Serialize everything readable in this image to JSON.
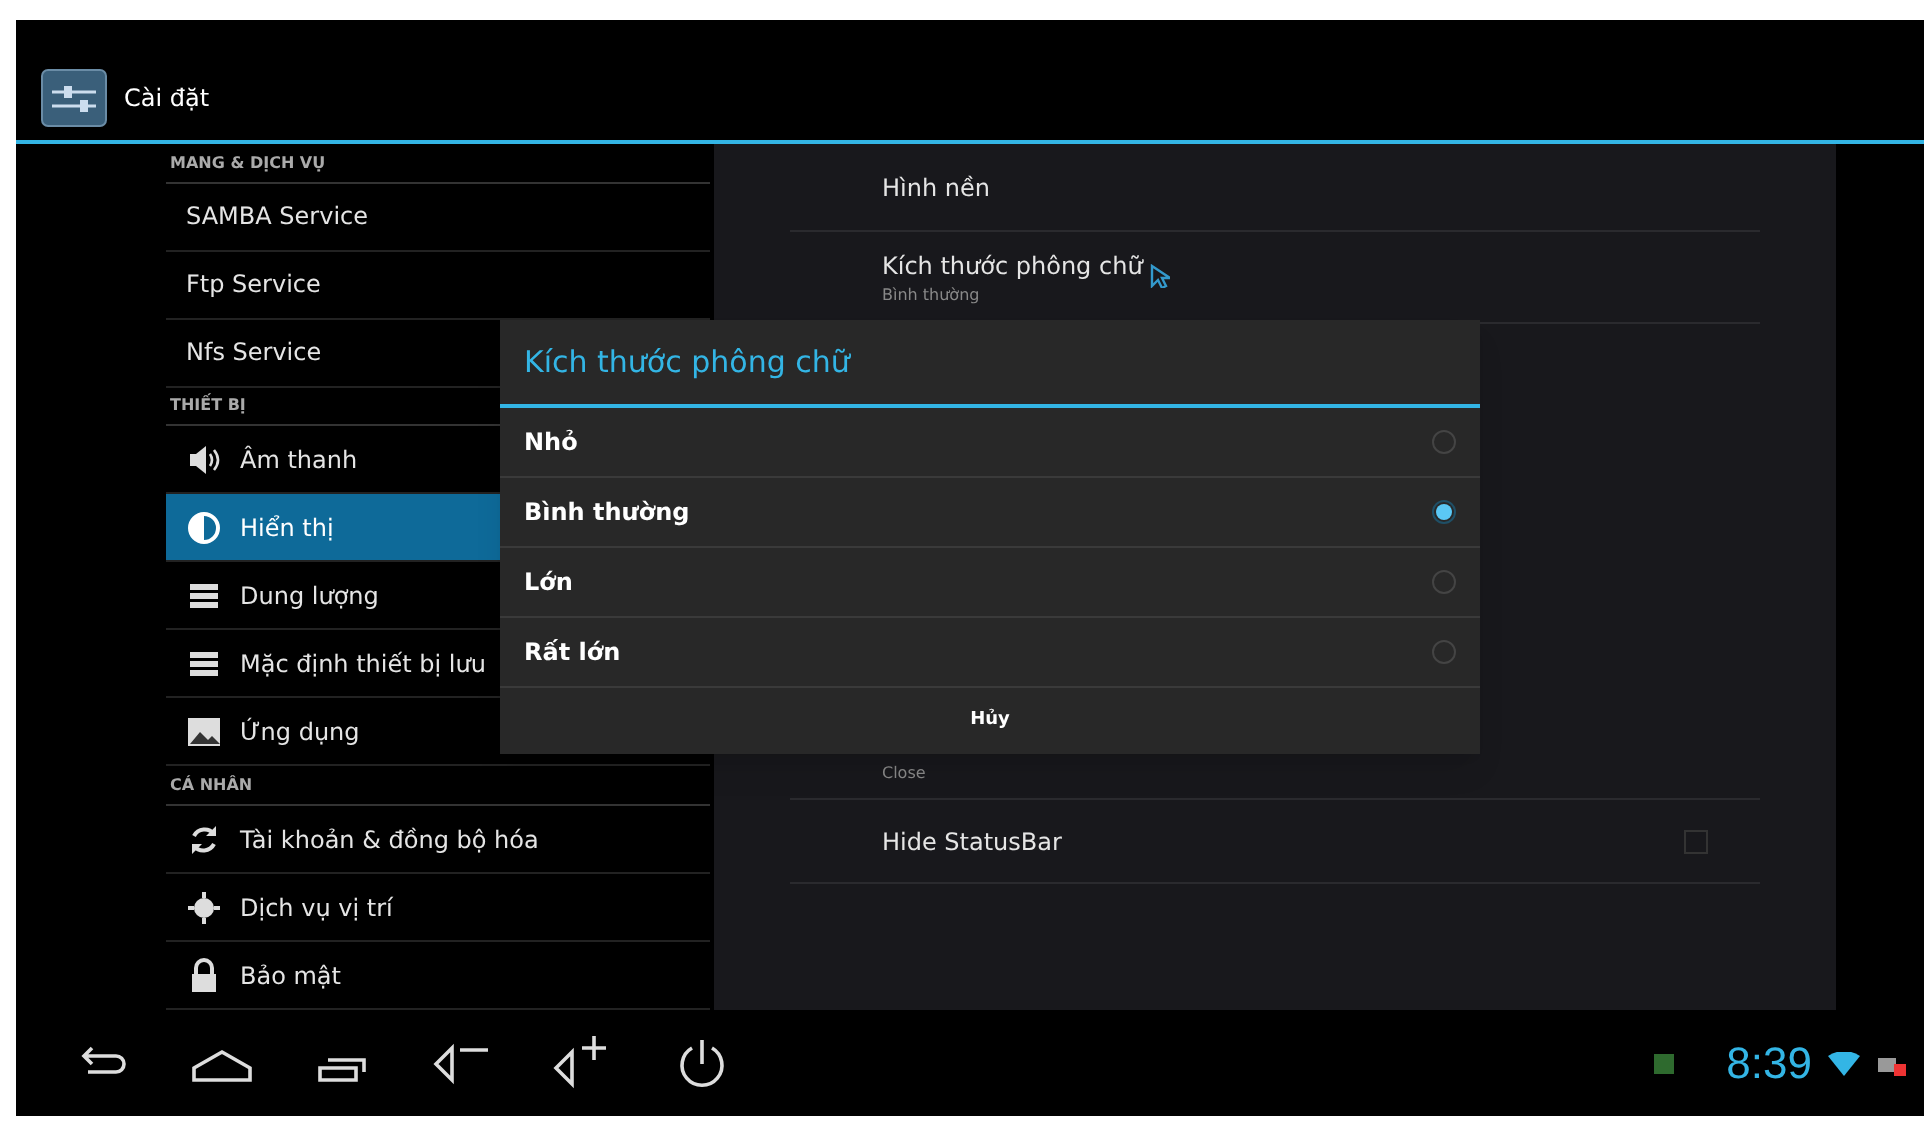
{
  "title_bar": {
    "title": "Cài đặt"
  },
  "sidebar": {
    "items": [
      {
        "kind": "header",
        "label": "MANG & DỊCH VỤ"
      },
      {
        "kind": "item",
        "label": "SAMBA Service",
        "selected": false
      },
      {
        "kind": "item",
        "label": "Ftp Service",
        "selected": false
      },
      {
        "kind": "item",
        "label": "Nfs Service",
        "selected": false
      },
      {
        "kind": "header",
        "label": "THIẾT BỊ"
      },
      {
        "kind": "item",
        "label": "Âm thanh",
        "selected": false
      },
      {
        "kind": "item",
        "label": "Hiển thị",
        "selected": true
      },
      {
        "kind": "item",
        "label": "Dung lượng",
        "selected": false
      },
      {
        "kind": "item",
        "label": "Mặc định thiết bị lưu",
        "selected": false
      },
      {
        "kind": "item",
        "label": "Ứng dụng",
        "selected": false
      },
      {
        "kind": "header",
        "label": "CÁ NHÂN"
      },
      {
        "kind": "item",
        "label": "Tài khoản & đồng bộ hóa",
        "selected": false
      },
      {
        "kind": "item",
        "label": "Dịch vụ vị trí",
        "selected": false
      },
      {
        "kind": "item",
        "label": "Bảo mật",
        "selected": false
      }
    ]
  },
  "settings": {
    "items": [
      {
        "kind": "text",
        "title": "Hình nền"
      },
      {
        "kind": "text",
        "title": "Kích thước phông chữ",
        "summary": "Bình thường"
      },
      {
        "kind": "summary",
        "summary": "Close"
      },
      {
        "kind": "checkbox",
        "title": "Hide StatusBar",
        "checked": false
      }
    ]
  },
  "dialog": {
    "title": "Kích thước phông chữ",
    "options": [
      {
        "label": "Nhỏ",
        "selected": false
      },
      {
        "label": "Bình thường",
        "selected": true
      },
      {
        "label": "Lớn",
        "selected": false
      },
      {
        "label": "Rất lớn",
        "selected": false
      }
    ],
    "cancel": "Hủy"
  },
  "status_bar": {
    "time": "8:39"
  }
}
